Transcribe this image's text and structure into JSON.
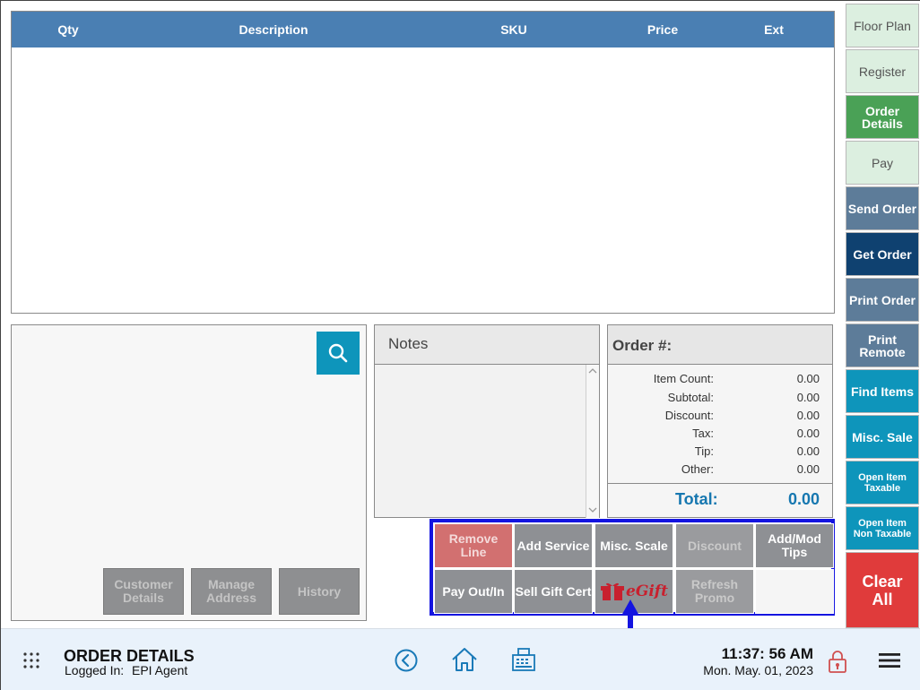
{
  "table": {
    "columns": [
      "Qty",
      "Description",
      "SKU",
      "Price",
      "Ext"
    ]
  },
  "customer": {
    "buttons": [
      "Customer Details",
      "Manage Address",
      "History"
    ]
  },
  "notes": {
    "title": "Notes"
  },
  "order": {
    "title": "Order #:",
    "rows": [
      {
        "label": "Item Count:",
        "value": "0.00"
      },
      {
        "label": "Subtotal:",
        "value": "0.00"
      },
      {
        "label": "Discount:",
        "value": "0.00"
      },
      {
        "label": "Tax:",
        "value": "0.00"
      },
      {
        "label": "Tip:",
        "value": "0.00"
      },
      {
        "label": "Other:",
        "value": "0.00"
      }
    ],
    "total_label": "Total:",
    "total_value": "0.00"
  },
  "actions": {
    "remove_line": "Remove Line",
    "add_service": "Add Service",
    "misc_scale": "Misc. Scale",
    "discount": "Discount",
    "add_mod_tips": "Add/Mod Tips",
    "pay_out_in": "Pay Out/In",
    "sell_gift_cert": "Sell Gift Cert",
    "egift": "eGift",
    "refresh_promo": "Refresh Promo"
  },
  "sidebar": {
    "items": [
      {
        "label": "Floor Plan",
        "color": "#dcefe0"
      },
      {
        "label": "Register",
        "color": "#dcefe0"
      },
      {
        "label": "Order Details",
        "color": "#4aa156"
      },
      {
        "label": "Pay",
        "color": "#dcefe0"
      },
      {
        "label": "Send Order",
        "color": "#5d7c99"
      },
      {
        "label": "Get Order",
        "color": "#0f4170"
      },
      {
        "label": "Print Order",
        "color": "#5d7c99"
      },
      {
        "label": "Print Remote",
        "color": "#5d7c99"
      },
      {
        "label": "Find Items",
        "color": "#0e95bb"
      },
      {
        "label": "Misc. Sale",
        "color": "#0e95bb"
      },
      {
        "label": "Open Item Taxable",
        "color": "#0e95bb"
      },
      {
        "label": "Open Item Non Taxable",
        "color": "#0e95bb"
      },
      {
        "label": "Clear All",
        "color": "#e03b3b"
      }
    ]
  },
  "footer": {
    "page_title": "ORDER DETAILS",
    "logged_in_label": "Logged In:",
    "logged_in_user": "EPI Agent",
    "time": "11:37: 56 AM",
    "date": "Mon. May. 01, 2023",
    "icons": [
      "apps-grid-icon",
      "back-circle-icon",
      "home-icon",
      "cash-register-icon",
      "lock-icon",
      "hamburger-menu-icon"
    ]
  },
  "colors": {
    "header_blue": "#4a7fb3",
    "accent_teal": "#0e95bb",
    "highlight_blue": "#1414e0",
    "total_blue": "#1677b0",
    "egift_red": "#c8202e"
  }
}
